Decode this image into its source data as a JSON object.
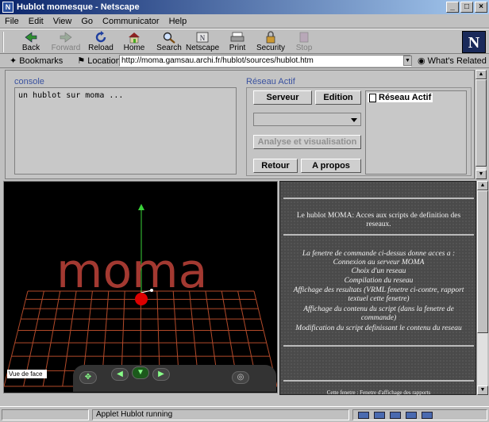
{
  "window": {
    "title": "Hublot momesque - Netscape"
  },
  "menu": [
    "File",
    "Edit",
    "View",
    "Go",
    "Communicator",
    "Help"
  ],
  "toolbar": [
    {
      "label": "Back",
      "icon": "back-arrow-icon",
      "enabled": true
    },
    {
      "label": "Forward",
      "icon": "forward-arrow-icon",
      "enabled": false
    },
    {
      "label": "Reload",
      "icon": "reload-icon",
      "enabled": true
    },
    {
      "label": "Home",
      "icon": "home-icon",
      "enabled": true
    },
    {
      "label": "Search",
      "icon": "search-icon",
      "enabled": true
    },
    {
      "label": "Netscape",
      "icon": "netscape-icon",
      "enabled": true
    },
    {
      "label": "Print",
      "icon": "print-icon",
      "enabled": true
    },
    {
      "label": "Security",
      "icon": "lock-icon",
      "enabled": true
    },
    {
      "label": "Stop",
      "icon": "stop-icon",
      "enabled": false
    }
  ],
  "location": {
    "bookmarks_label": "Bookmarks",
    "location_label": "Location:",
    "url": "http://moma.gamsau.archi.fr/hublot/sources/hublot.htm",
    "related_label": "What's Related"
  },
  "applet": {
    "console_label": "console",
    "console_text": "un hublot sur moma ...",
    "reseau_label": "Réseau Actif",
    "buttons": {
      "serveur": "Serveur",
      "edition": "Edition",
      "analyse": "Analyse et visualisation",
      "retour": "Retour",
      "apropos": "A propos"
    },
    "tree_node": "Réseau Actif"
  },
  "vrml": {
    "model_text": "moma",
    "view_label": "Vue de face",
    "colors": {
      "text": "#c0433a",
      "grid": "#b24a2a",
      "axis": "#3ad23a",
      "sphere": "#dd0000"
    }
  },
  "panel": {
    "intro": "Le hublot MOMA: Acces aux scripts de definition des reseaux.",
    "lines": [
      "La fenetre de commande ci-dessus donne acces a :",
      "Connexion au serveur MOMA",
      "Choix d'un reseau",
      "Compilation du reseau",
      "Affichage des resultats (VRML fenetre ci-contre, rapport textuel cette fenetre)",
      "Affichage du contenu du script (dans la fenetre de commande)",
      "Modification du script definissant le contenu du reseau"
    ],
    "footer": "Cette fenetre : Fenetre d'affichage des rapports"
  },
  "status": {
    "text": "Applet Hublot running"
  }
}
